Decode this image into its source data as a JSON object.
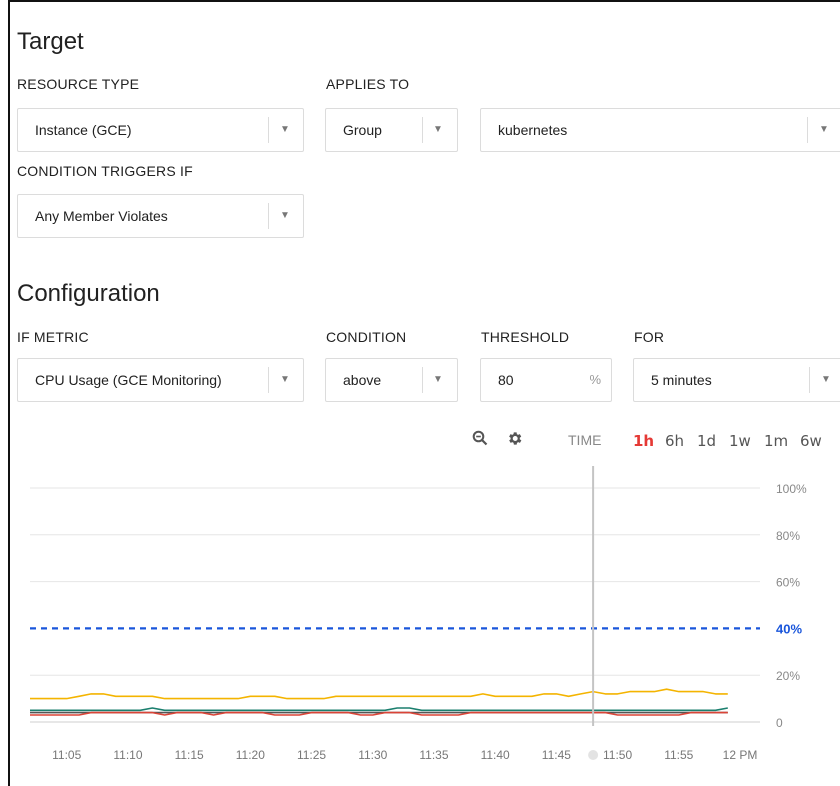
{
  "target": {
    "title": "Target",
    "resource_type": {
      "label": "RESOURCE TYPE",
      "value": "Instance (GCE)"
    },
    "applies_to": {
      "label": "APPLIES TO",
      "value": "Group",
      "group_value": "kubernetes"
    },
    "condition_triggers": {
      "label": "CONDITION TRIGGERS IF",
      "value": "Any Member Violates"
    }
  },
  "configuration": {
    "title": "Configuration",
    "if_metric": {
      "label": "IF METRIC",
      "value": "CPU Usage (GCE Monitoring)"
    },
    "condition": {
      "label": "CONDITION",
      "value": "above"
    },
    "threshold": {
      "label": "THRESHOLD",
      "value": "80",
      "unit": "%"
    },
    "for": {
      "label": "FOR",
      "value": "5 minutes"
    }
  },
  "chart_toolbar": {
    "time_label": "TIME",
    "ranges": [
      "1h",
      "6h",
      "1d",
      "1w",
      "1m",
      "6w"
    ],
    "active_range": "1h",
    "zoom_icon": "zoom-icon",
    "settings_icon": "gear-icon"
  },
  "colors": {
    "threshold_line": "#1a56db",
    "series_yellow": "#f4b400",
    "series_teal": "#1b7f6e",
    "series_red": "#db4437",
    "series_gray": "#555555",
    "active_range": "#e53935"
  },
  "chart_data": {
    "type": "line",
    "x": [
      "11:02",
      "11:03",
      "11:04",
      "11:05",
      "11:06",
      "11:07",
      "11:08",
      "11:09",
      "11:10",
      "11:11",
      "11:12",
      "11:13",
      "11:14",
      "11:15",
      "11:16",
      "11:17",
      "11:18",
      "11:19",
      "11:20",
      "11:21",
      "11:22",
      "11:23",
      "11:24",
      "11:25",
      "11:26",
      "11:27",
      "11:28",
      "11:29",
      "11:30",
      "11:31",
      "11:32",
      "11:33",
      "11:34",
      "11:35",
      "11:36",
      "11:37",
      "11:38",
      "11:39",
      "11:40",
      "11:41",
      "11:42",
      "11:43",
      "11:44",
      "11:45",
      "11:46",
      "11:47",
      "11:48",
      "11:49",
      "11:50",
      "11:51",
      "11:52",
      "11:53",
      "11:54",
      "11:55",
      "11:56",
      "11:57",
      "11:58",
      "11:59"
    ],
    "x_ticks": [
      "11:05",
      "11:10",
      "11:15",
      "11:20",
      "11:25",
      "11:30",
      "11:35",
      "11:40",
      "11:45",
      "11:50",
      "11:55",
      "12 PM"
    ],
    "y_ticks": [
      "0",
      "20%",
      "40%",
      "60%",
      "80%",
      "100%"
    ],
    "ylim": [
      0,
      100
    ],
    "threshold": {
      "value": 40,
      "label": "40%"
    },
    "series": [
      {
        "color": "#f4b400",
        "values": [
          10,
          10,
          10,
          10,
          11,
          12,
          12,
          11,
          11,
          11,
          11,
          10,
          10,
          10,
          10,
          10,
          10,
          10,
          11,
          11,
          11,
          10,
          10,
          10,
          10,
          11,
          11,
          11,
          11,
          11,
          11,
          11,
          11,
          11,
          11,
          11,
          11,
          12,
          11,
          11,
          11,
          11,
          12,
          12,
          11,
          12,
          13,
          12,
          12,
          13,
          13,
          13,
          14,
          13,
          13,
          13,
          12,
          12
        ]
      },
      {
        "color": "#1b7f6e",
        "values": [
          5,
          5,
          5,
          5,
          5,
          5,
          5,
          5,
          5,
          5,
          6,
          5,
          5,
          5,
          5,
          5,
          5,
          5,
          5,
          5,
          5,
          5,
          5,
          5,
          5,
          5,
          5,
          5,
          5,
          5,
          6,
          6,
          5,
          5,
          5,
          5,
          5,
          5,
          5,
          5,
          5,
          5,
          5,
          5,
          5,
          5,
          5,
          5,
          5,
          5,
          5,
          5,
          5,
          5,
          5,
          5,
          5,
          6
        ]
      },
      {
        "color": "#db4437",
        "values": [
          3,
          3,
          3,
          3,
          3,
          4,
          4,
          4,
          4,
          4,
          4,
          3,
          4,
          4,
          4,
          3,
          4,
          4,
          4,
          4,
          3,
          3,
          3,
          4,
          4,
          4,
          4,
          3,
          3,
          4,
          4,
          4,
          3,
          3,
          3,
          3,
          4,
          4,
          4,
          4,
          4,
          4,
          4,
          4,
          4,
          4,
          4,
          4,
          3,
          3,
          3,
          3,
          3,
          3,
          4,
          4,
          4,
          4
        ]
      },
      {
        "color": "#555555",
        "values": [
          4,
          4,
          4,
          4,
          4,
          4,
          4,
          4,
          4,
          4,
          4,
          4,
          4,
          4,
          4,
          4,
          4,
          4,
          4,
          4,
          4,
          4,
          4,
          4,
          4,
          4,
          4,
          4,
          4,
          4,
          4,
          4,
          4,
          4,
          4,
          4,
          4,
          4,
          4,
          4,
          4,
          4,
          4,
          4,
          4,
          4,
          4,
          4,
          4,
          4,
          4,
          4,
          4,
          4,
          4,
          4,
          4,
          4
        ]
      }
    ],
    "cursor_x": "11:48",
    "grid": true
  }
}
